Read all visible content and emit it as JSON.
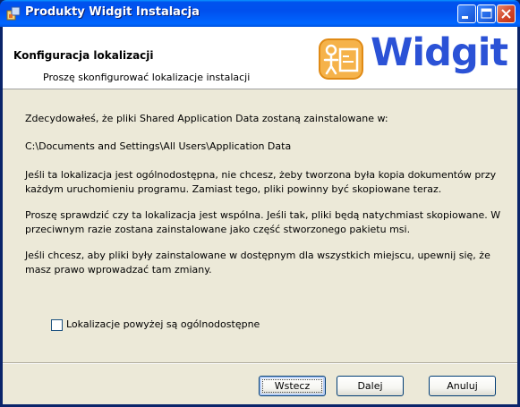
{
  "window": {
    "title": "Produkty Widgit Instalacja"
  },
  "header": {
    "title": "Konfiguracja lokalizacji",
    "subtitle": "Proszę skonfigurować lokalizacje instalacji",
    "logo_text": "Widgit",
    "logo_color": "#2b52d6"
  },
  "body": {
    "p1": "Zdecydowałeś, że pliki Shared Application Data zostaną zainstalowane w:",
    "path": "C:\\Documents and Settings\\All Users\\Application Data",
    "p3_line1": "Jeśli ta lokalizacja jest ogólnodostępna, nie chcesz, żeby tworzona była kopia dokumentów przy",
    "p3_line2": "każdym uruchomieniu programu. Zamiast tego, pliki powinny być skopiowane teraz.",
    "p4_line1": "Proszę sprawdzić czy ta lokalizacja jest wspólna. Jeśli tak, pliki będą natychmiast skopiowane. W",
    "p4_line2": "przeciwnym razie zostana zainstalowane jako część stworzonego pakietu msi.",
    "p5_line1": "Jeśli chcesz, aby pliki były zainstalowane w dostępnym dla wszystkich miejscu, upewnij się, że",
    "p5_line2": "masz prawo wprowadzać tam zmiany."
  },
  "checkbox": {
    "label": "Lokalizacje powyżej są ogólnodostępne",
    "checked": false
  },
  "buttons": {
    "back": "Wstecz",
    "next": "Dalej",
    "cancel": "Anuluj"
  },
  "icons": {
    "window": "installer-icon",
    "minimize": "minimize-icon",
    "maximize": "maximize-icon",
    "close": "close-icon"
  }
}
